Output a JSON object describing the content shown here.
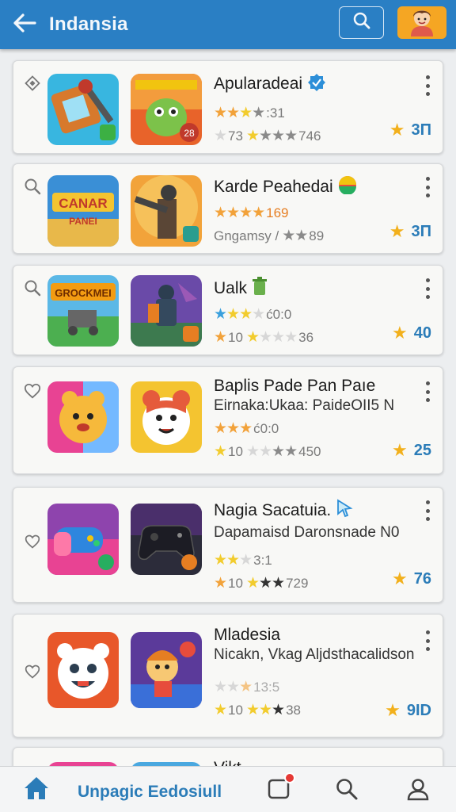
{
  "header": {
    "title": "Indansia",
    "back_icon": "back-arrow-icon",
    "search_icon": "search-icon",
    "avatar_icon": "avatar-icon"
  },
  "apps": [
    {
      "lead_icon": "diamond-icon",
      "name": "Apularadeai",
      "name_badge": "verified-badge-icon",
      "subtitle": "",
      "rating_primary": ":31",
      "rating_secondary": "73",
      "rating_secondary_tail": "746",
      "score": "3П"
    },
    {
      "lead_icon": "search-icon",
      "name": "Karde Peahedai",
      "name_badge": "rainbow-badge-icon",
      "subtitle": "",
      "rating_primary": "169",
      "rating_secondary": "Gngamsy /",
      "rating_secondary_tail": "89",
      "score": "3П"
    },
    {
      "lead_icon": "search-icon",
      "name": "Ualk",
      "name_badge": "trash-badge-icon",
      "subtitle": "",
      "rating_primary": "ć0:0",
      "rating_secondary": "10",
      "rating_secondary_tail": "36",
      "score": "40"
    },
    {
      "lead_icon": "heart-icon",
      "name": "Baplis Pade Pan Paıe",
      "name_badge": "",
      "subtitle": "Eirnaka:Ukaa: PaideOII5 N",
      "rating_primary": "ć0:0",
      "rating_secondary": "10",
      "rating_secondary_tail": "450",
      "score": "25"
    },
    {
      "lead_icon": "heart-icon",
      "name": "Nagia Sacatuia.",
      "name_badge": "cursor-badge-icon",
      "subtitle": "Dapamaisd Daronsnade N0",
      "rating_primary": "3:1",
      "rating_secondary": "10",
      "rating_secondary_tail": "729",
      "score": "76"
    },
    {
      "lead_icon": "heart-icon",
      "name": "Mladesia",
      "name_badge": "",
      "subtitle": "Nicakn, Vkag Aljdsthacalidson",
      "rating_primary": "13:5",
      "rating_secondary": "10",
      "rating_secondary_tail": "38",
      "score": "9ID"
    }
  ],
  "partial_item": {
    "name": "Vikt"
  },
  "bottom_nav": {
    "label": "Unpagic Eedosiull",
    "home_icon": "home-icon",
    "inbox_icon": "inbox-icon",
    "search_icon": "search-icon",
    "profile_icon": "profile-icon"
  },
  "colors": {
    "header_bg": "#2a7fc4",
    "accent": "#2b7cb8",
    "star": "#f2b01c",
    "card_bg": "#f8f8f6"
  }
}
